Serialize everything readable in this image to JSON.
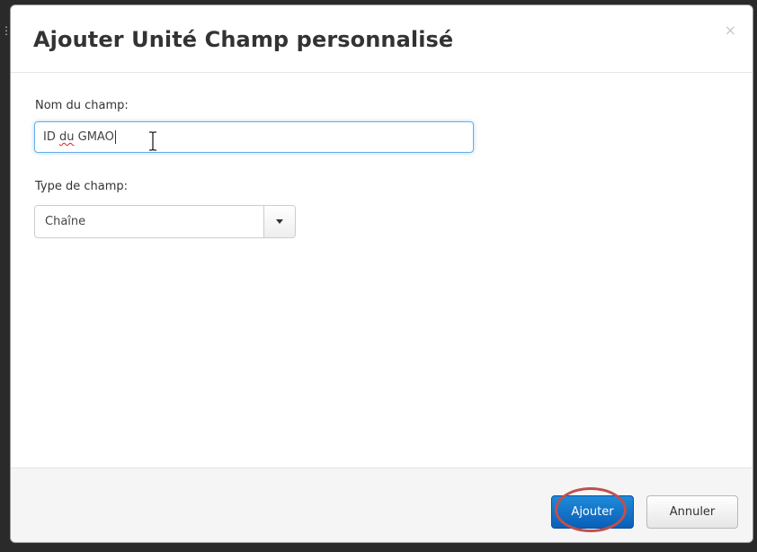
{
  "dialog": {
    "title": "Ajouter Unité Champ personnalisé",
    "close_glyph": "×"
  },
  "form": {
    "name_label": "Nom du champ:",
    "name_value_part1": "ID ",
    "name_value_misspelled": "du",
    "name_value_part2": " GMAO",
    "type_label": "Type de champ:",
    "type_selected": "Chaîne"
  },
  "footer": {
    "add_label": "Ajouter",
    "cancel_label": "Annuler"
  },
  "colors": {
    "primary_button": "#0a6fc9",
    "focus_border": "#66afe9",
    "annotation_ring": "#c0504d"
  },
  "icons": {
    "close": "close-icon",
    "dropdown": "chevron-down-icon",
    "text_cursor": "ibeam-cursor-icon"
  }
}
